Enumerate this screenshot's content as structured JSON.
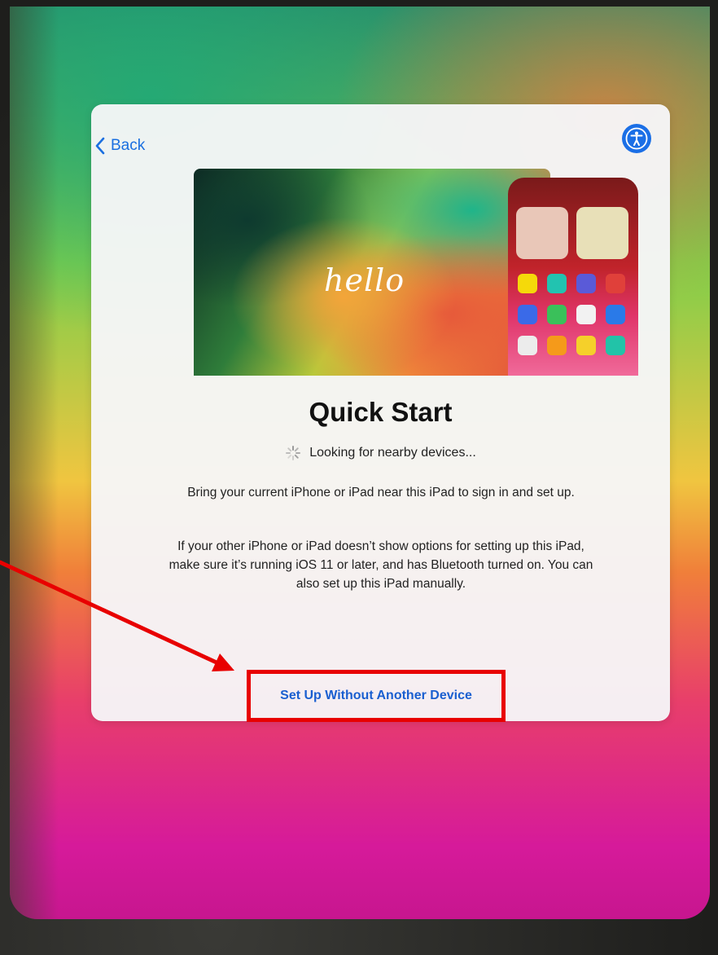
{
  "nav": {
    "back_label": "Back",
    "accessibility_icon": "accessibility-icon"
  },
  "hero": {
    "greeting": "hello"
  },
  "content": {
    "title": "Quick Start",
    "status": "Looking for nearby devices...",
    "paragraph1": "Bring your current iPhone or iPad near this iPad to sign in and set up.",
    "paragraph2": "If your other iPhone or iPad doesn’t show options for setting up this iPad, make sure it’s running iOS 11 or later, and has Bluetooth turned on. You can also set up this iPad manually."
  },
  "actions": {
    "setup_without_device": "Set Up Without Another Device"
  },
  "colors": {
    "accent": "#1a6fe0",
    "highlight": "#e80000"
  }
}
